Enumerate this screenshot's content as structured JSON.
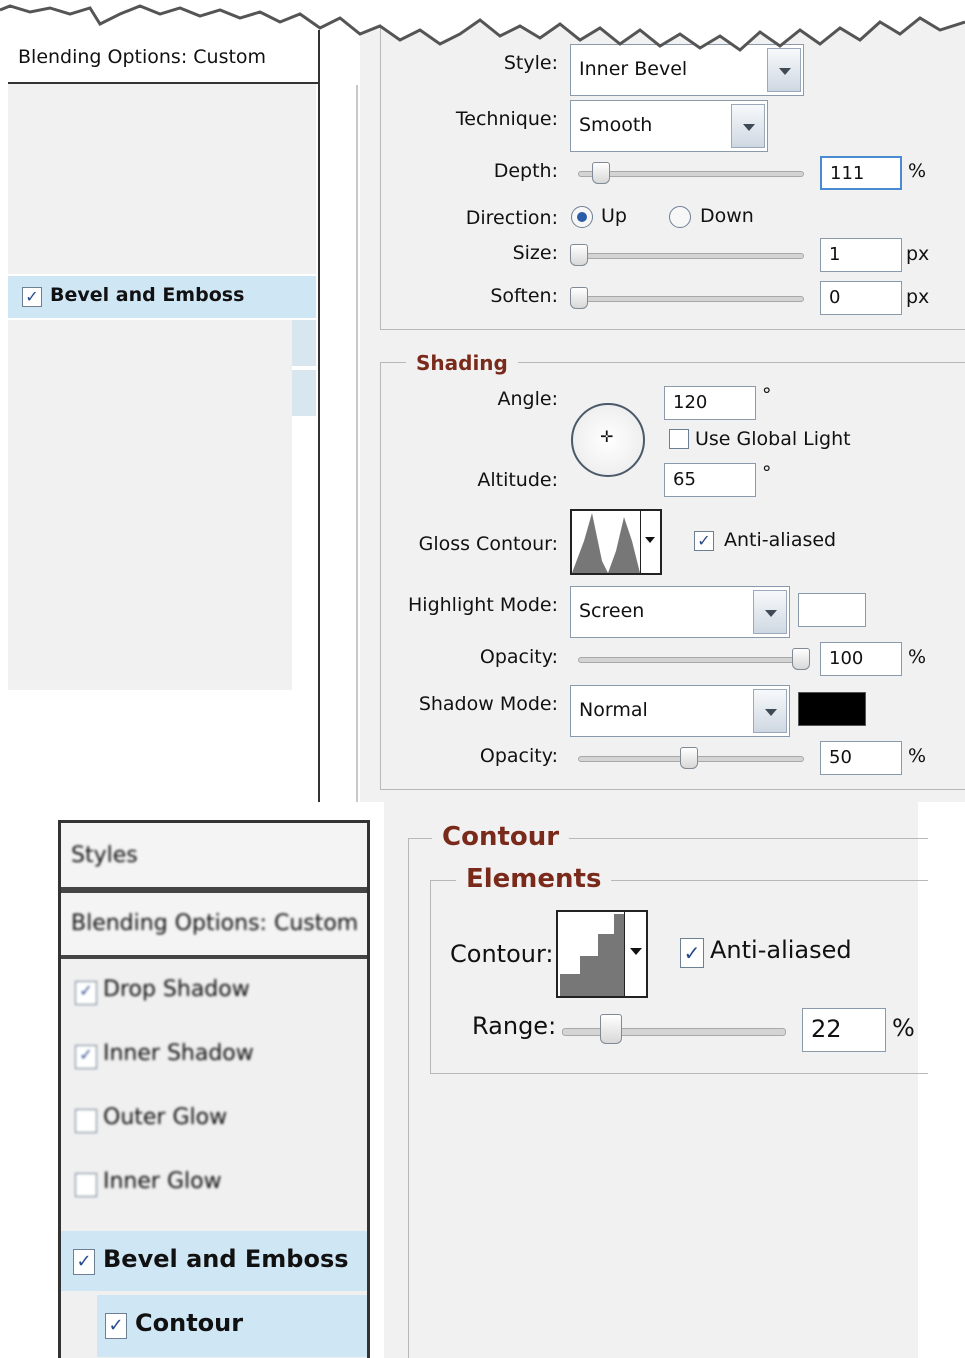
{
  "top_panel": {
    "sidebar": {
      "blending_options": "Blending Options: Custom",
      "bevel_and_emboss": "Bevel and Emboss",
      "bevel_checked": "✓"
    },
    "structure": {
      "style_label": "Style:",
      "style_value": "Inner Bevel",
      "technique_label": "Technique:",
      "technique_value": "Smooth",
      "depth_label": "Depth:",
      "depth_value": "111",
      "depth_unit": "%",
      "depth_level_pct": 10,
      "direction_label": "Direction:",
      "direction_up": "Up",
      "direction_down": "Down",
      "direction_selected": "Up",
      "size_label": "Size:",
      "size_value": "1",
      "size_unit": "px",
      "soften_label": "Soften:",
      "soften_value": "0",
      "soften_unit": "px"
    },
    "shading": {
      "title": "Shading",
      "angle_label": "Angle:",
      "angle_value": "120",
      "degree_symbol": "°",
      "use_global_light": "Use Global Light",
      "altitude_label": "Altitude:",
      "altitude_value": "65",
      "gloss_contour_label": "Gloss Contour:",
      "anti_aliased": "Anti-aliased",
      "highlight_mode_label": "Highlight Mode:",
      "highlight_mode_value": "Screen",
      "highlight_color": "#ffffff",
      "opacity_label": "Opacity:",
      "highlight_opacity_value": "100",
      "highlight_opacity_pct": 100,
      "shadow_mode_label": "Shadow Mode:",
      "shadow_mode_value": "Normal",
      "shadow_color": "#000000",
      "shadow_opacity_value": "50",
      "shadow_opacity_pct": 50,
      "percent": "%"
    }
  },
  "bottom_panel": {
    "sidebar": {
      "styles": "Styles",
      "blending_options": "Blending Options: Custom",
      "items": [
        {
          "label": "Drop Shadow",
          "checked": true
        },
        {
          "label": "Inner Shadow",
          "checked": true
        },
        {
          "label": "Outer Glow",
          "checked": false
        },
        {
          "label": "Inner Glow",
          "checked": false
        }
      ],
      "bevel_and_emboss": "Bevel and Emboss",
      "contour": "Contour"
    },
    "contour": {
      "title": "Contour",
      "subtitle": "Elements",
      "contour_label": "Contour:",
      "anti_aliased": "Anti-aliased",
      "range_label": "Range:",
      "range_value": "22",
      "range_unit": "%",
      "range_level_pct": 22
    }
  },
  "colors": {
    "selected_row": "#cfe6f5",
    "section_title": "#7a2a1a",
    "panel_bg": "#f1f1f1"
  }
}
